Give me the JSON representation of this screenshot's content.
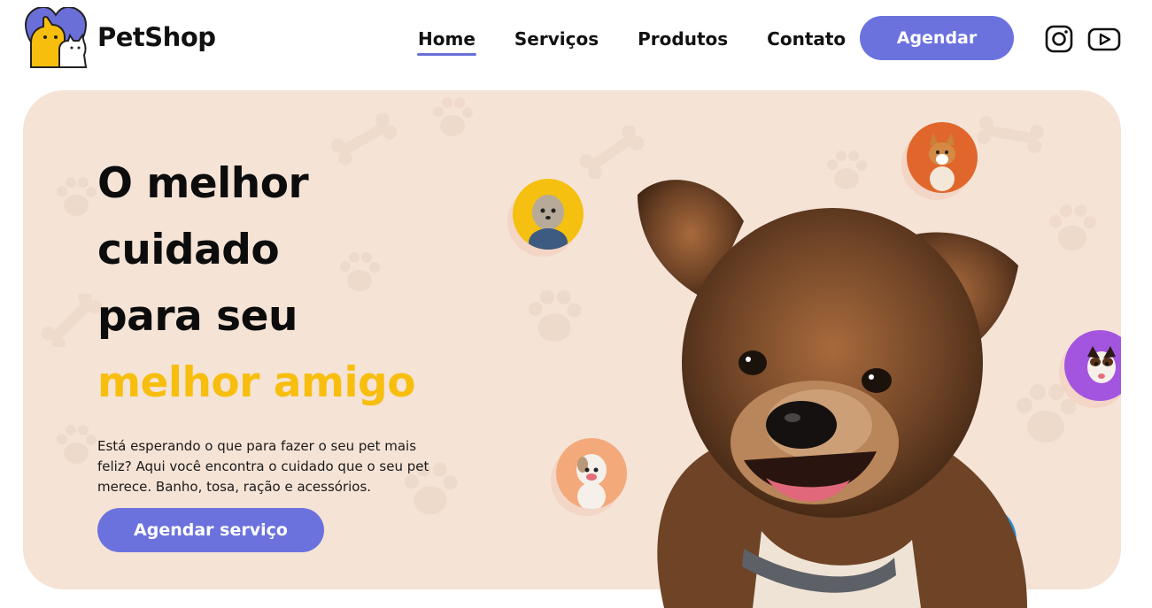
{
  "brand": {
    "name": "PetShop"
  },
  "nav": {
    "items": [
      {
        "label": "Home",
        "active": true
      },
      {
        "label": "Serviços",
        "active": false
      },
      {
        "label": "Produtos",
        "active": false
      },
      {
        "label": "Contato",
        "active": false
      }
    ],
    "cta_label": "Agendar"
  },
  "social": {
    "icons": [
      "instagram-icon",
      "youtube-icon"
    ]
  },
  "hero": {
    "headline_lines": [
      "O melhor",
      "cuidado",
      "para seu"
    ],
    "headline_highlight": "melhor amigo",
    "description": "Está esperando o que para fazer o seu pet mais feliz? Aqui você encontra o cuidado que o seu pet merece. Banho, tosa, ração e acessórios.",
    "cta_label": "Agendar serviço"
  },
  "colors": {
    "accent": "#6b72dd",
    "highlight": "#f7be0e",
    "hero_bg": "#f5e3d6",
    "bubble_yellow": "#f5c00f",
    "bubble_orange": "#e0662c",
    "bubble_peach": "#f3a97a",
    "bubble_blue": "#2a8fd6",
    "bubble_purple": "#a455e0"
  }
}
